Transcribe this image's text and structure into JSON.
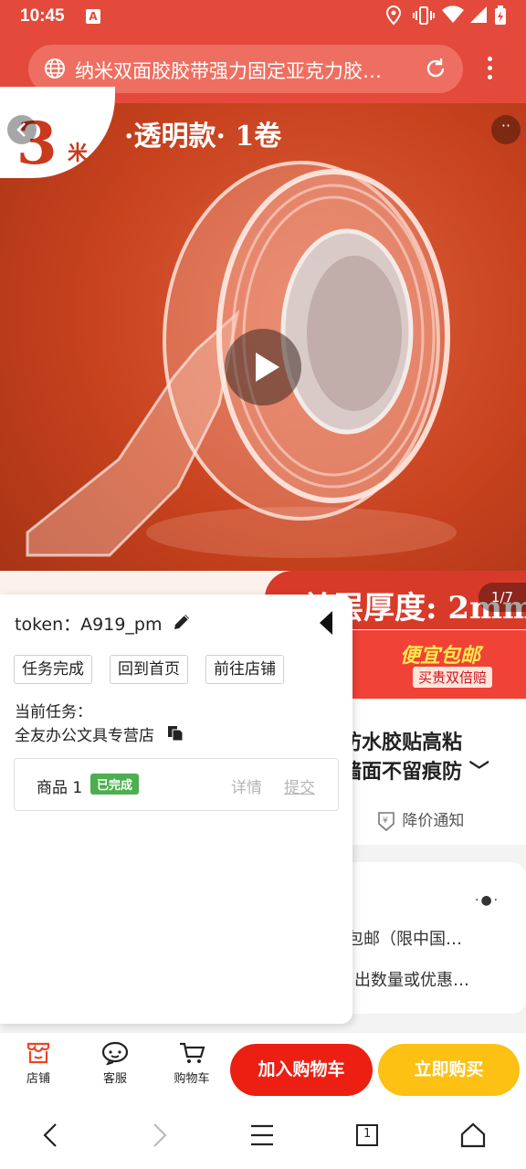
{
  "status_bar": {
    "time": "10:45",
    "notif_glyph": "A"
  },
  "browser": {
    "url_title": "纳米双面胶胶带强力固定亚克力胶…"
  },
  "hero": {
    "badge_number": "3",
    "badge_unit": "米",
    "title": "·透明款· 1卷",
    "strip_text": "单层厚度: 2mm",
    "pager": "1/7"
  },
  "promo": {
    "line1": "便宜包邮",
    "line2": "买贵双倍赔"
  },
  "product": {
    "title_line1": "防水胶贴高粘",
    "title_line2": "墙面不留痕防",
    "price_notice": "降价通知",
    "shipping_line1": "包邮（限中国…",
    "shipping_line2": "出数量或优惠…"
  },
  "panel": {
    "token_label": "token：",
    "token_value": "A919_pm",
    "buttons": [
      "任务完成",
      "回到首页",
      "前往店铺"
    ],
    "task_label": "当前任务：",
    "task_value": "全友办公文具专营店",
    "item": {
      "name": "商品 1",
      "badge": "已完成",
      "detail": "详情",
      "submit": "提交"
    }
  },
  "action_bar": {
    "shop": "店铺",
    "service": "客服",
    "cart_icon_label": "购物车",
    "add_cart": "加入购物车",
    "buy_now": "立即购买"
  },
  "nav": {
    "tabs_count": "1"
  },
  "colors": {
    "brand_red": "#e44a3b",
    "buy_yellow": "#fcc113",
    "cart_red": "#ec1f12",
    "done_green": "#4cae4f"
  }
}
